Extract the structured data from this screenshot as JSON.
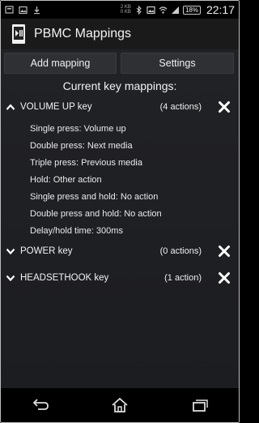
{
  "status_bar": {
    "rate_top": "2 KB",
    "rate_bottom": "0 KB",
    "battery": "18%",
    "time": "22:17"
  },
  "app": {
    "title": "PBMC Mappings"
  },
  "toolbar": {
    "add_label": "Add mapping",
    "settings_label": "Settings"
  },
  "list": {
    "header": "Current key mappings:",
    "groups": [
      {
        "label": "VOLUME UP key",
        "count": "(4 actions)",
        "expanded": true,
        "items": [
          "Single press: Volume up",
          "Double press: Next media",
          "Triple press: Previous media",
          "Hold: Other action",
          "Single press and hold: No action",
          "Double press and hold: No action",
          "Delay/hold time: 300ms"
        ]
      },
      {
        "label": "POWER key",
        "count": "(0 actions)",
        "expanded": false
      },
      {
        "label": "HEADSETHOOK key",
        "count": "(1 action)",
        "expanded": false
      }
    ]
  }
}
